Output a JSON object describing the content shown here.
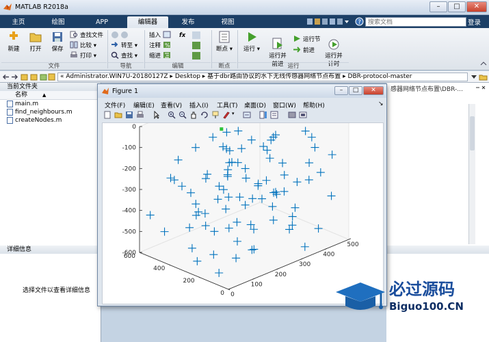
{
  "app": {
    "title": "MATLAB R2018a"
  },
  "window_controls": {
    "minimize": "–",
    "maximize": "□",
    "close": "✕"
  },
  "tabs": [
    {
      "label": "主页"
    },
    {
      "label": "绘图"
    },
    {
      "label": "APP"
    },
    {
      "label": "编辑器"
    },
    {
      "label": "发布"
    },
    {
      "label": "视图"
    }
  ],
  "search": {
    "placeholder": "搜索文档"
  },
  "login": "登录",
  "ribbon": {
    "file": {
      "new": "新建",
      "open": "打开",
      "save": "保存",
      "find_files": "查找文件",
      "compare": "比较",
      "print": "打印",
      "group": "文件"
    },
    "nav": {
      "goto": "转至",
      "find": "查找",
      "group": "导航"
    },
    "edit": {
      "insert": "插入",
      "fx": "fx",
      "comment": "注释",
      "indent": "缩进",
      "group": "编辑"
    },
    "breakpoints": {
      "label": "断点",
      "group": "断点"
    },
    "run": {
      "run": "运行",
      "run_advance": "运行并\n前进",
      "run_section": "运行节",
      "advance": "前进",
      "run_time": "运行并\n计时",
      "group": "运行"
    }
  },
  "address": {
    "path": "« Administrator.WIN7U-20180127Z ▸ Desktop ▸ 基于dbr路由协议的水下无线传感器网络节点布置 ▸ DBR-protocol-master"
  },
  "current_folder": {
    "title": "当前文件夹",
    "column": "名称",
    "sort": "▲",
    "files": [
      "main.m",
      "find_neighbours.m",
      "createNodes.m"
    ]
  },
  "details": {
    "title": "详细信息",
    "message": "选择文件以查看详细信息"
  },
  "right_pane": {
    "path_fragment": "感器网络节点布置\\DBR-..."
  },
  "figure": {
    "title": "Figure 1",
    "menu": [
      "文件(F)",
      "编辑(E)",
      "查看(V)",
      "插入(I)",
      "工具(T)",
      "桌面(D)",
      "窗口(W)",
      "帮助(H)"
    ],
    "toolbar_icons": [
      "new-figure-icon",
      "open-icon",
      "save-icon",
      "print-icon",
      "pointer-icon",
      "zoom-in-icon",
      "zoom-out-icon",
      "pan-icon",
      "rotate-icon",
      "data-cursor-icon",
      "brush-icon",
      "link-icon",
      "colorbar-icon",
      "legend-icon",
      "hide-plot-tools-icon",
      "show-plot-tools-icon"
    ]
  },
  "chart_data": {
    "type": "scatter",
    "title": "",
    "xlabel": "",
    "ylabel": "",
    "zlabel": "",
    "xlim": [
      0,
      500
    ],
    "ylim": [
      0,
      600
    ],
    "zlim": [
      -600,
      0
    ],
    "xticks": [
      0,
      100,
      200,
      300,
      400,
      500
    ],
    "yticks": [
      0,
      200,
      400,
      600
    ],
    "zticks": [
      0,
      -100,
      -200,
      -300,
      -400,
      -500,
      -600
    ],
    "marker": "+",
    "series": [
      {
        "color": "#0072bd",
        "points": [
          [
            15,
            28,
            -45
          ],
          [
            45,
            50,
            -30
          ],
          [
            380,
            420,
            -60
          ],
          [
            120,
            300,
            -20
          ],
          [
            250,
            500,
            -15
          ],
          [
            400,
            300,
            -40
          ],
          [
            90,
            140,
            -80
          ],
          [
            300,
            200,
            -90
          ],
          [
            210,
            80,
            -60
          ],
          [
            460,
            520,
            -70
          ],
          [
            60,
            240,
            -150
          ],
          [
            150,
            180,
            -120
          ],
          [
            330,
            470,
            -140
          ],
          [
            420,
            120,
            -110
          ],
          [
            270,
            350,
            -160
          ],
          [
            50,
            420,
            -130
          ],
          [
            190,
            530,
            -170
          ],
          [
            480,
            260,
            -150
          ],
          [
            110,
            60,
            -140
          ],
          [
            360,
            40,
            -180
          ],
          [
            30,
            120,
            -220
          ],
          [
            230,
            260,
            -210
          ],
          [
            410,
            430,
            -240
          ],
          [
            140,
            380,
            -250
          ],
          [
            300,
            110,
            -230
          ],
          [
            80,
            520,
            -260
          ],
          [
            470,
            180,
            -200
          ],
          [
            200,
            20,
            -240
          ],
          [
            350,
            560,
            -270
          ],
          [
            10,
            330,
            -210
          ],
          [
            170,
            200,
            -300
          ],
          [
            440,
            350,
            -310
          ],
          [
            60,
            40,
            -320
          ],
          [
            280,
            460,
            -330
          ],
          [
            390,
            90,
            -290
          ],
          [
            120,
            560,
            -300
          ],
          [
            250,
            180,
            -340
          ],
          [
            20,
            250,
            -330
          ],
          [
            330,
            280,
            -320
          ],
          [
            480,
            500,
            -350
          ],
          [
            100,
            320,
            -380
          ],
          [
            230,
            70,
            -400
          ],
          [
            370,
            400,
            -390
          ],
          [
            440,
            20,
            -370
          ],
          [
            160,
            480,
            -410
          ],
          [
            40,
            160,
            -390
          ],
          [
            300,
            520,
            -420
          ],
          [
            210,
            340,
            -360
          ],
          [
            470,
            300,
            -400
          ],
          [
            80,
            70,
            -430
          ],
          [
            150,
            240,
            -450
          ],
          [
            260,
            440,
            -470
          ],
          [
            400,
            200,
            -460
          ],
          [
            30,
            480,
            -480
          ],
          [
            340,
            120,
            -450
          ],
          [
            490,
            420,
            -490
          ],
          [
            110,
            20,
            -470
          ],
          [
            220,
            560,
            -500
          ],
          [
            380,
            320,
            -480
          ],
          [
            60,
            360,
            -440
          ],
          [
            180,
            120,
            -530
          ],
          [
            290,
            300,
            -540
          ],
          [
            420,
            520,
            -520
          ],
          [
            10,
            80,
            -550
          ],
          [
            330,
            20,
            -560
          ],
          [
            250,
            560,
            -580
          ],
          [
            460,
            140,
            -570
          ],
          [
            120,
            440,
            -590
          ],
          [
            370,
            450,
            -600
          ],
          [
            80,
            230,
            -540
          ],
          [
            205,
            345,
            -50
          ],
          [
            215,
            355,
            -260
          ],
          [
            195,
            330,
            -120
          ],
          [
            325,
            225,
            -95
          ],
          [
            345,
            235,
            -380
          ],
          [
            140,
            290,
            -260
          ],
          [
            270,
            120,
            -300
          ],
          [
            430,
            380,
            -180
          ],
          [
            90,
            400,
            -300
          ],
          [
            310,
            390,
            -460
          ],
          [
            250,
            250,
            -80
          ],
          [
            160,
            60,
            -200
          ],
          [
            420,
            60,
            -260
          ],
          [
            20,
            560,
            -420
          ],
          [
            290,
            60,
            -470
          ],
          [
            480,
            80,
            -210
          ],
          [
            130,
            160,
            -560
          ],
          [
            230,
            410,
            -150
          ],
          [
            370,
            170,
            -520
          ],
          [
            55,
            300,
            -580
          ]
        ]
      }
    ],
    "highlight_point": {
      "color": "#2ec43a",
      "point": [
        205,
        380,
        -45
      ]
    },
    "view": {
      "azimuth": -37.5,
      "elevation": 30
    }
  },
  "watermark": {
    "cn": "必过源码",
    "en": "Biguo100.CN"
  }
}
